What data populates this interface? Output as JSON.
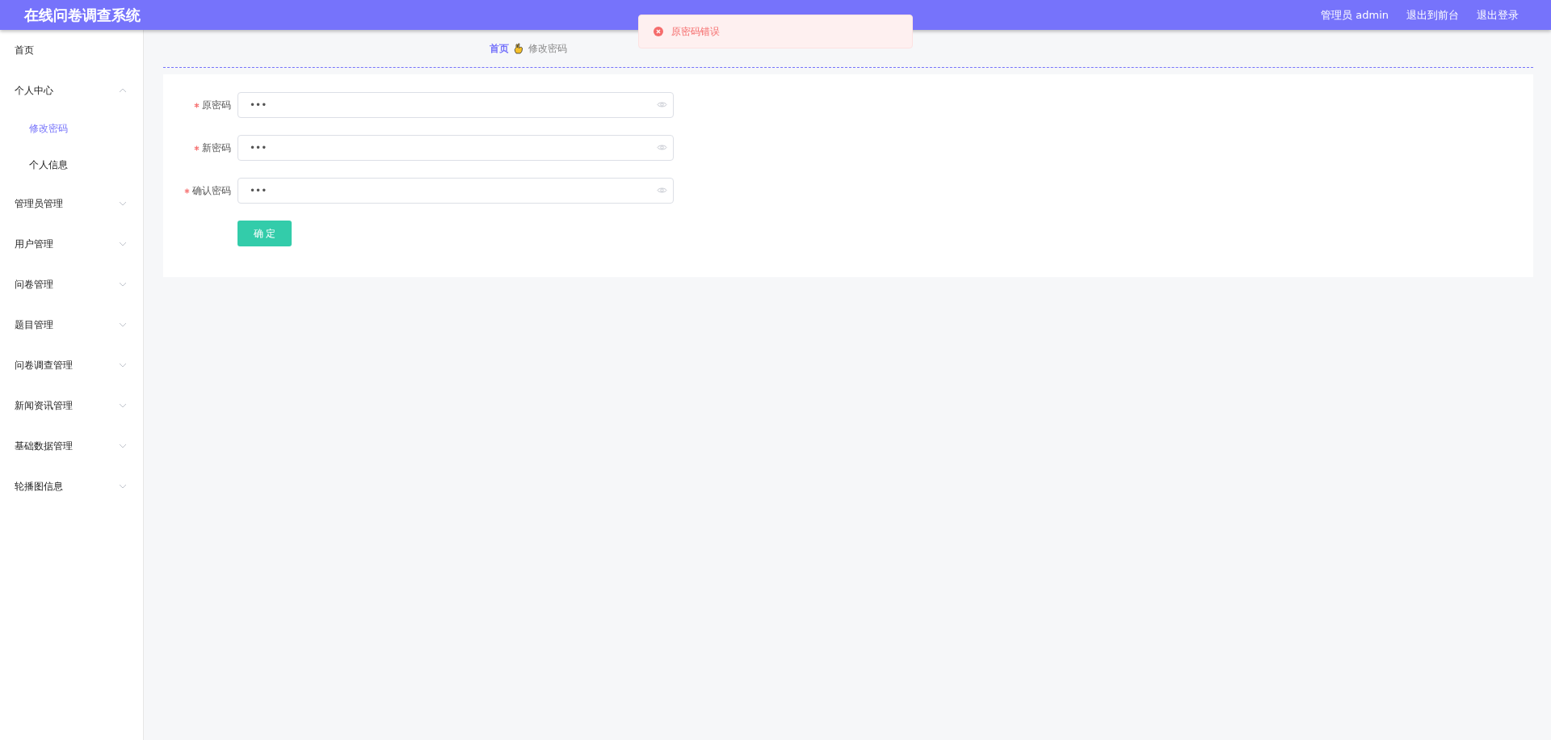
{
  "header": {
    "title": "在线问卷调查系统",
    "links": [
      "管理员 admin",
      "退出到前台",
      "退出登录"
    ]
  },
  "toast": {
    "kind": "error",
    "message": "原密码错误"
  },
  "sidebar": {
    "items": [
      {
        "label": "首页"
      },
      {
        "label": "个人中心",
        "expanded": true,
        "children": [
          {
            "label": "修改密码",
            "selected": true
          },
          {
            "label": "个人信息",
            "selected": false
          }
        ]
      },
      {
        "label": "管理员管理",
        "expanded": false
      },
      {
        "label": "用户管理",
        "expanded": false
      },
      {
        "label": "问卷管理",
        "expanded": false
      },
      {
        "label": "题目管理",
        "expanded": false
      },
      {
        "label": "问卷调查管理",
        "expanded": false
      },
      {
        "label": "新闻资讯管理",
        "expanded": false
      },
      {
        "label": "基础数据管理",
        "expanded": false
      },
      {
        "label": "轮播图信息",
        "expanded": false
      }
    ]
  },
  "breadcrumb": [
    "首页",
    "修改密码"
  ],
  "form": {
    "fields": [
      {
        "label": "原密码",
        "required": true,
        "value": "•••"
      },
      {
        "label": "新密码",
        "required": true,
        "value": "•••"
      },
      {
        "label": "确认密码",
        "required": true,
        "value": "•••"
      }
    ],
    "submit": "确 定"
  }
}
